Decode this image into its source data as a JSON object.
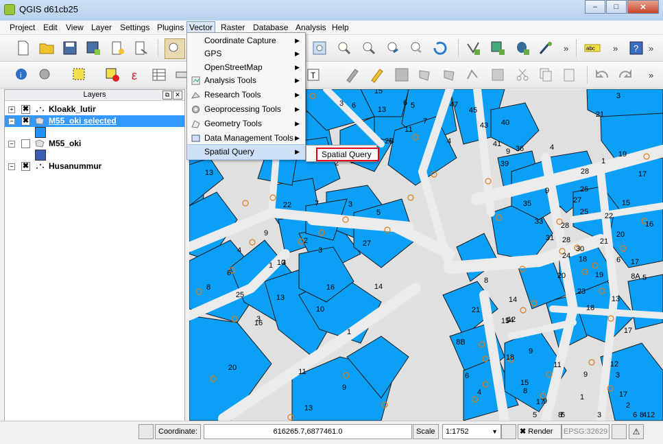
{
  "window": {
    "title": "QGIS d61cb25",
    "buttons": {
      "min": "–",
      "max": "□",
      "close": "✕"
    }
  },
  "menubar": [
    "Project",
    "Edit",
    "View",
    "Layer",
    "Settings",
    "Plugins",
    "Vector",
    "Raster",
    "Database",
    "Analysis",
    "Help"
  ],
  "vector_menu": {
    "items": [
      {
        "label": "Coordinate Capture",
        "icon": "none",
        "submenu": true
      },
      {
        "label": "GPS",
        "icon": "none",
        "submenu": true
      },
      {
        "label": "OpenStreetMap",
        "icon": "none",
        "submenu": true
      },
      {
        "label": "Analysis Tools",
        "icon": "analysis-icon",
        "submenu": true
      },
      {
        "label": "Research Tools",
        "icon": "research-icon",
        "submenu": true
      },
      {
        "label": "Geoprocessing Tools",
        "icon": "geoprocessing-icon",
        "submenu": true
      },
      {
        "label": "Geometry Tools",
        "icon": "geometry-icon",
        "submenu": true
      },
      {
        "label": "Data Management Tools",
        "icon": "data-management-icon",
        "submenu": true
      },
      {
        "label": "Spatial Query",
        "icon": "none",
        "submenu": true
      }
    ],
    "highlighted": "Spatial Query"
  },
  "submenu": {
    "item": "Spatial Query"
  },
  "layers_panel": {
    "title": "Layers",
    "layers": [
      {
        "name": "Kloakk_lutir",
        "checked": true,
        "expanded": true
      },
      {
        "name": "M55_oki selected",
        "checked": true,
        "expanded": true,
        "selected": true,
        "swatch": "#1e90ff"
      },
      {
        "name": "M55_oki",
        "checked": false,
        "expanded": true,
        "swatch": "#3c5cb4"
      },
      {
        "name": "Husanummur",
        "checked": true,
        "expanded": true
      }
    ]
  },
  "statusbar": {
    "coordinate_label": "Coordinate:",
    "coordinate_value": "616265.7,6877461.0",
    "scale_label": "Scale",
    "scale_value": "1:1752",
    "render_label": "Render",
    "crs": "EPSG:32629"
  },
  "map": {
    "parcel_labels": [
      "3",
      "6",
      "15",
      "2",
      "47",
      "45",
      "40",
      "5",
      "13",
      "6",
      "7",
      "21",
      "11",
      "2B",
      "43",
      "3",
      "41",
      "4",
      "9",
      "36",
      "39",
      "4",
      "19",
      "28",
      "1",
      "17",
      "1",
      "13",
      "7",
      "22",
      "3",
      "5",
      "9",
      "26",
      "15",
      "27",
      "35",
      "16",
      "25",
      "28",
      "33",
      "22",
      "30",
      "9",
      "31",
      "20",
      "21",
      "28",
      "6",
      "8",
      "4",
      "1",
      "3",
      "27",
      "24",
      "18",
      "6",
      "2",
      "3",
      "17",
      "25",
      "16",
      "19",
      "14",
      "8",
      "23",
      "20",
      "13",
      "10",
      "5",
      "3",
      "10",
      "8A",
      "14",
      "12",
      "15",
      "21",
      "18",
      "13",
      "16",
      "1",
      "14",
      "17",
      "20",
      "8B",
      "18",
      "9",
      "12",
      "11",
      "6",
      "11",
      "9",
      "3",
      "4",
      "15",
      "17",
      "13",
      "9",
      "8",
      "17",
      "9",
      "2",
      "1",
      "7",
      "8",
      "6",
      "3",
      "5",
      "4",
      "6",
      "8",
      "12"
    ],
    "colors": {
      "parcel": "#0b9ff6",
      "road": "#ebebeb",
      "marker": "#e07b1a"
    }
  }
}
